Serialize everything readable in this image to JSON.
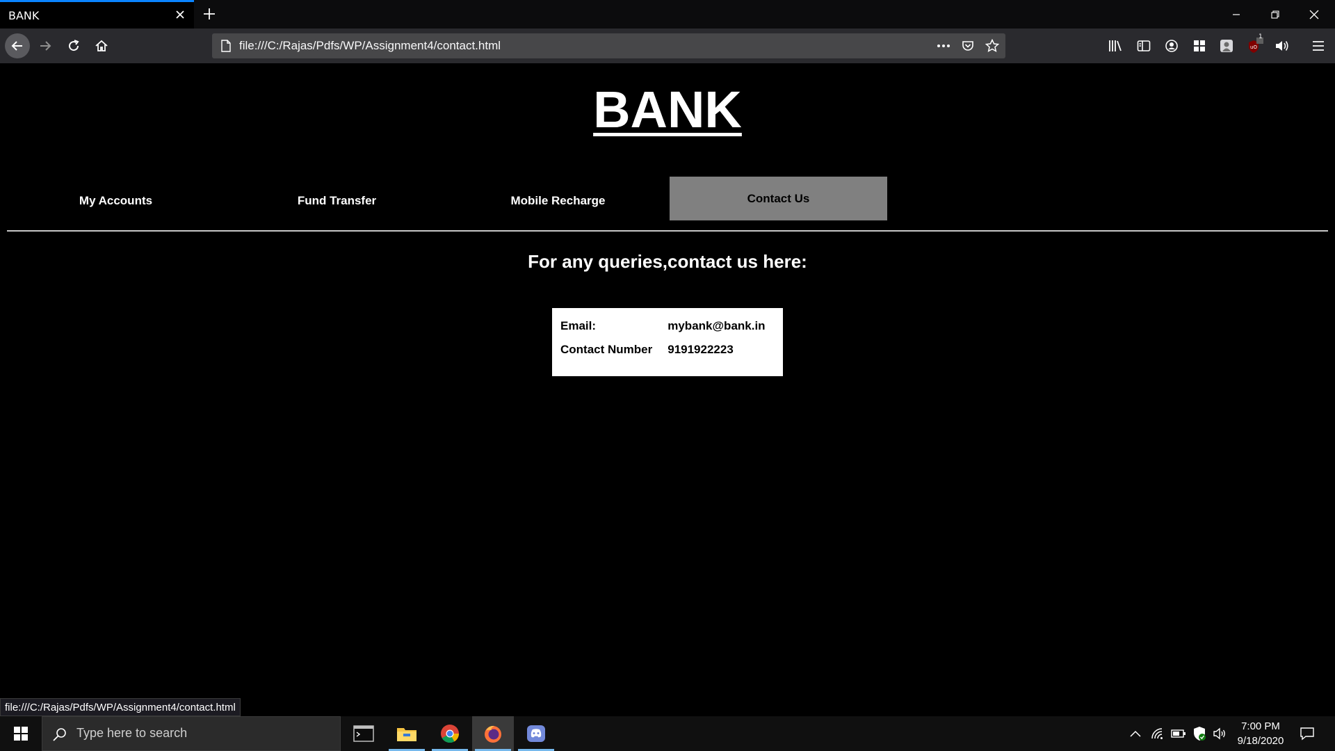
{
  "browser": {
    "tab_title": "BANK",
    "url": "file:///C:/Rajas/Pdfs/WP/Assignment4/contact.html",
    "status_url": "file:///C:/Rajas/Pdfs/WP/Assignment4/contact.html",
    "ublock_badge": "1",
    "accent_color": "#0a84ff"
  },
  "page": {
    "brand": "BANK",
    "nav": [
      {
        "label": "My Accounts",
        "active": false
      },
      {
        "label": "Fund Transfer",
        "active": false
      },
      {
        "label": "Mobile Recharge",
        "active": false
      },
      {
        "label": "Contact Us",
        "active": true
      }
    ],
    "heading": "For any queries,contact us here:",
    "contact": {
      "rows": [
        {
          "label": "Email:",
          "value": "mybank@bank.in"
        },
        {
          "label": "Contact Number",
          "value": "9191922223"
        }
      ]
    }
  },
  "taskbar": {
    "search_placeholder": "Type here to search",
    "time": "7:00 PM",
    "date": "9/18/2020",
    "apps": [
      "terminal-icon",
      "file-explorer-icon",
      "chrome-icon",
      "firefox-icon",
      "discord-icon"
    ]
  }
}
